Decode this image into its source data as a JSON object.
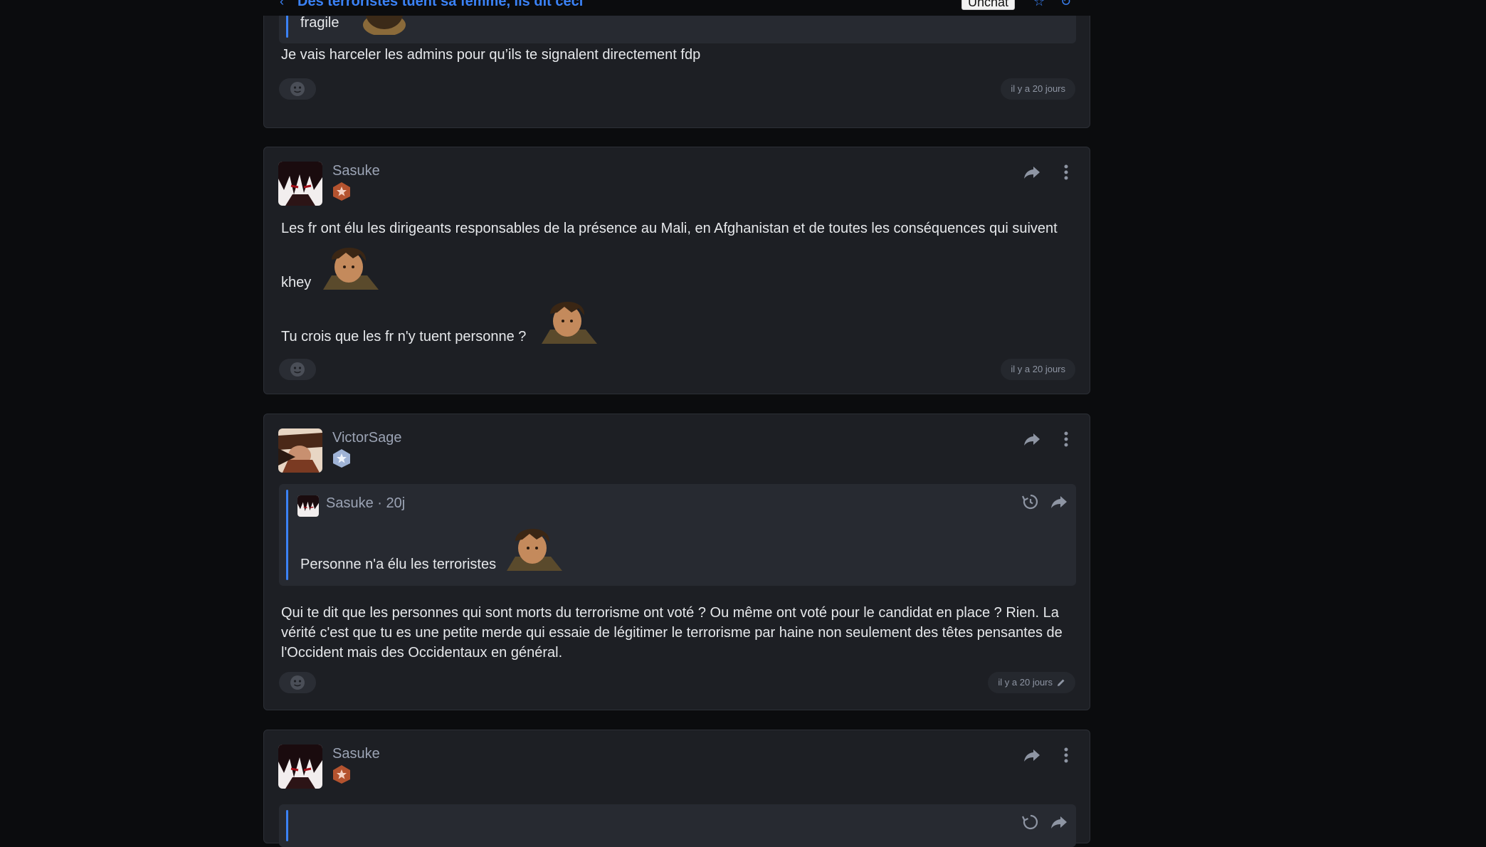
{
  "topbar": {
    "thread_title": "Des terroristes tuent sa femme, ils dit ceci",
    "unchat_label": "Unchat"
  },
  "posts": [
    {
      "quote_fragment": "fragile",
      "text": "Je vais harceler les admins pour qu’ils te signalent directement fdp",
      "time": "il y a 20 jours"
    },
    {
      "author": "Sasuke",
      "badge_color": "#b4532f",
      "line1": "Les fr ont élu les dirigeants responsables de la présence au Mali, en Afghanistan et de toutes les conséquences qui suivent",
      "line2": "khey",
      "line3": "Tu crois que les fr n'y tuent personne ?",
      "time": "il y a 20 jours"
    },
    {
      "author": "VictorSage",
      "badge_color": "#9fb3d6",
      "quote": {
        "author": "Sasuke · 20j",
        "text": "Personne n'a élu les terroristes"
      },
      "paragraph": "Qui te dit que les personnes qui sont morts du terrorisme ont voté ? Ou même ont voté pour le candidat en place ? Rien. La vérité c'est que tu es une petite merde qui essaie de légitimer le terrorisme par haine non seulement des têtes pensantes de l'Occident mais des Occidentaux en général.",
      "time": "il y a 20 jours"
    },
    {
      "author": "Sasuke",
      "badge_color": "#b4532f"
    }
  ],
  "colors": {
    "accent": "#3b82f6",
    "card_bg": "#1d1f24",
    "page_bg": "#0b0c0e"
  }
}
